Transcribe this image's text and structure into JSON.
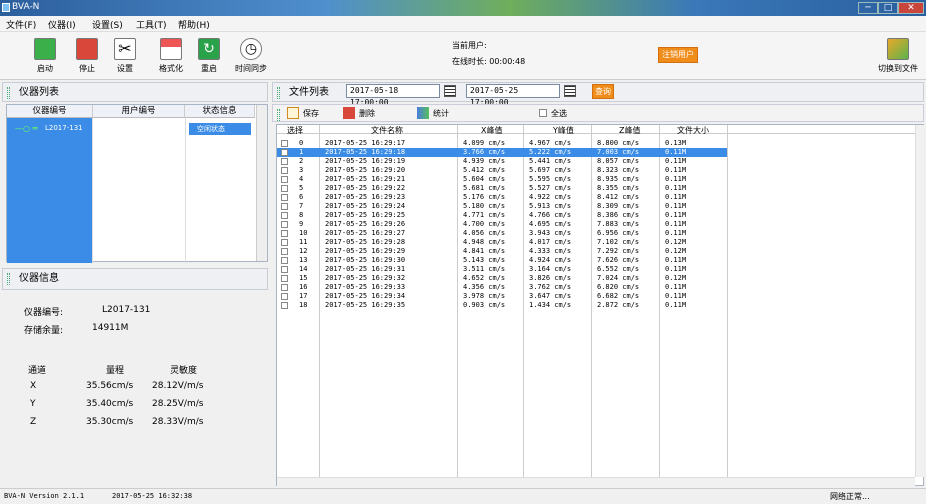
{
  "window": {
    "title": "BVA-N"
  },
  "menu": [
    "文件(F)",
    "仪器(I)",
    "设置(S)",
    "工具(T)",
    "帮助(H)"
  ],
  "toolbar": {
    "start": "启动",
    "stop": "停止",
    "settings": "设置",
    "format": "格式化",
    "restart": "重启",
    "timesync": "时间同步",
    "user_label": "当前用户:",
    "online_label": "在线时长: 00:00:48",
    "logout": "注销用户",
    "switch": "切换到文件"
  },
  "device_list": {
    "title": "仪器列表",
    "columns": [
      "仪器编号",
      "用户编号",
      "状态信息"
    ],
    "rows": [
      {
        "id": "L2017-131",
        "user": "",
        "status": "空闲状态"
      }
    ]
  },
  "device_info": {
    "title": "仪器信息",
    "id_label": "仪器编号:",
    "id_value": "L2017-131",
    "storage_label": "存储余量:",
    "storage_value": "14911M",
    "table_headers": [
      "通道",
      "量程",
      "灵敏度"
    ],
    "channels": [
      {
        "ch": "X",
        "range": "35.56cm/s",
        "sens": "28.12V/m/s"
      },
      {
        "ch": "Y",
        "range": "35.40cm/s",
        "sens": "28.25V/m/s"
      },
      {
        "ch": "Z",
        "range": "35.30cm/s",
        "sens": "28.33V/m/s"
      }
    ]
  },
  "file_list": {
    "title": "文件列表",
    "start_time": "2017-05-18 17:00:00",
    "end_time": "2017-05-25 17:00:00",
    "query": "查询",
    "save": "保存",
    "delete": "删除",
    "stats": "统计",
    "select_all": "全选",
    "columns": [
      "选择",
      "文件名称",
      "X峰值",
      "Y峰值",
      "Z峰值",
      "文件大小"
    ],
    "rows": [
      [
        "0",
        "2017-05-25 16:29:17",
        "4.099 cm/s",
        "4.967 cm/s",
        "8.800 cm/s",
        "0.13M"
      ],
      [
        "1",
        "2017-05-25 16:29:18",
        "3.766 cm/s",
        "5.222 cm/s",
        "7.003 cm/s",
        "0.11M"
      ],
      [
        "2",
        "2017-05-25 16:29:19",
        "4.939 cm/s",
        "5.441 cm/s",
        "8.057 cm/s",
        "0.11M"
      ],
      [
        "3",
        "2017-05-25 16:29:20",
        "5.412 cm/s",
        "5.697 cm/s",
        "8.323 cm/s",
        "0.11M"
      ],
      [
        "4",
        "2017-05-25 16:29:21",
        "5.604 cm/s",
        "5.595 cm/s",
        "8.935 cm/s",
        "0.11M"
      ],
      [
        "5",
        "2017-05-25 16:29:22",
        "5.681 cm/s",
        "5.527 cm/s",
        "8.355 cm/s",
        "0.11M"
      ],
      [
        "6",
        "2017-05-25 16:29:23",
        "5.176 cm/s",
        "4.922 cm/s",
        "8.412 cm/s",
        "0.11M"
      ],
      [
        "7",
        "2017-05-25 16:29:24",
        "5.180 cm/s",
        "5.913 cm/s",
        "8.309 cm/s",
        "0.11M"
      ],
      [
        "8",
        "2017-05-25 16:29:25",
        "4.771 cm/s",
        "4.766 cm/s",
        "8.386 cm/s",
        "0.11M"
      ],
      [
        "9",
        "2017-05-25 16:29:26",
        "4.700 cm/s",
        "4.695 cm/s",
        "7.883 cm/s",
        "0.11M"
      ],
      [
        "10",
        "2017-05-25 16:29:27",
        "4.056 cm/s",
        "3.943 cm/s",
        "6.956 cm/s",
        "0.11M"
      ],
      [
        "11",
        "2017-05-25 16:29:28",
        "4.948 cm/s",
        "4.017 cm/s",
        "7.102 cm/s",
        "0.12M"
      ],
      [
        "12",
        "2017-05-25 16:29:29",
        "4.841 cm/s",
        "4.333 cm/s",
        "7.292 cm/s",
        "0.12M"
      ],
      [
        "13",
        "2017-05-25 16:29:30",
        "5.143 cm/s",
        "4.924 cm/s",
        "7.626 cm/s",
        "0.11M"
      ],
      [
        "14",
        "2017-05-25 16:29:31",
        "3.511 cm/s",
        "3.164 cm/s",
        "6.552 cm/s",
        "0.11M"
      ],
      [
        "15",
        "2017-05-25 16:29:32",
        "4.652 cm/s",
        "3.826 cm/s",
        "7.024 cm/s",
        "0.12M"
      ],
      [
        "16",
        "2017-05-25 16:29:33",
        "4.356 cm/s",
        "3.762 cm/s",
        "6.820 cm/s",
        "0.11M"
      ],
      [
        "17",
        "2017-05-25 16:29:34",
        "3.978 cm/s",
        "3.647 cm/s",
        "6.682 cm/s",
        "0.11M"
      ],
      [
        "18",
        "2017-05-25 16:29:35",
        "0.903 cm/s",
        "1.434 cm/s",
        "2.872 cm/s",
        "0.11M"
      ]
    ],
    "selected_row": 1
  },
  "status": {
    "version": "BVA-N Version 2.1.1",
    "time": "2017-05-25 16:32:38",
    "network": "网络正常..."
  },
  "colors": {
    "accent": "#3a8ce6",
    "orange": "#f08c1a"
  }
}
